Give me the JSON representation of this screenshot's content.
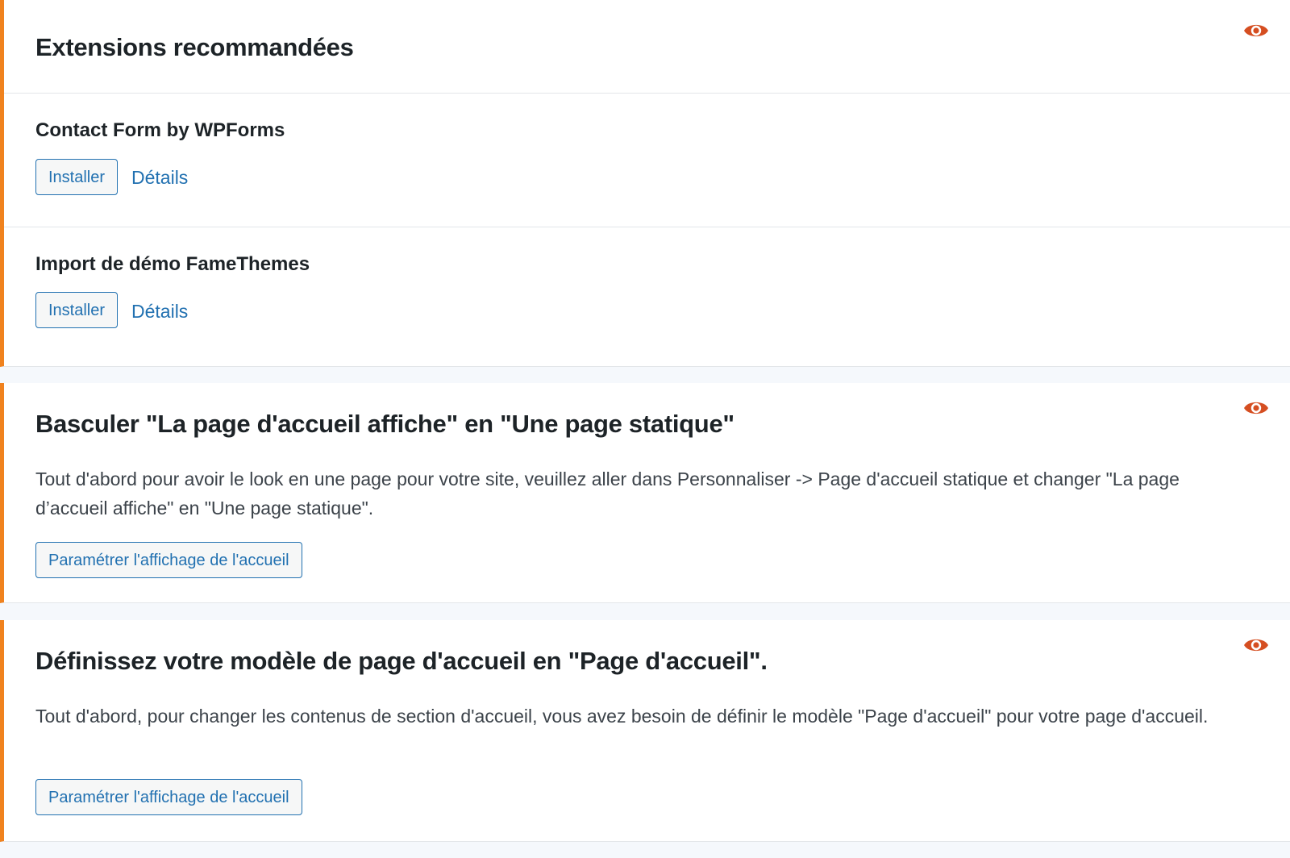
{
  "colors": {
    "accent_border": "#f0821e",
    "eye_icon": "#d54e21",
    "link": "#2271b1",
    "text": "#1d2327"
  },
  "extensions": {
    "title": "Extensions recommandées",
    "hide_icon": "eye-icon",
    "plugins": [
      {
        "name": "Contact Form by WPForms",
        "install_label": "Installer",
        "details_label": "Détails"
      },
      {
        "name": "Import de démo FameThemes",
        "install_label": "Installer",
        "details_label": "Détails"
      }
    ]
  },
  "actions": [
    {
      "title": "Basculer \"La page d'accueil affiche\" en \"Une page statique\"",
      "description": "Tout d'abord pour avoir le look en une page pour votre site, veuillez aller dans Personnaliser -> Page d'accueil statique et changer \"La page d’accueil affiche\" en \"Une page statique\".",
      "button_label": "Paramétrer l'affichage de l'accueil",
      "hide_icon": "eye-icon"
    },
    {
      "title": "Définissez votre modèle de page d'accueil en \"Page d'accueil\".",
      "description": "Tout d'abord, pour changer les contenus de section d'accueil, vous avez besoin de définir le modèle \"Page d'accueil\" pour votre page d'accueil.",
      "button_label": "Paramétrer l'affichage de l'accueil",
      "hide_icon": "eye-icon"
    }
  ]
}
